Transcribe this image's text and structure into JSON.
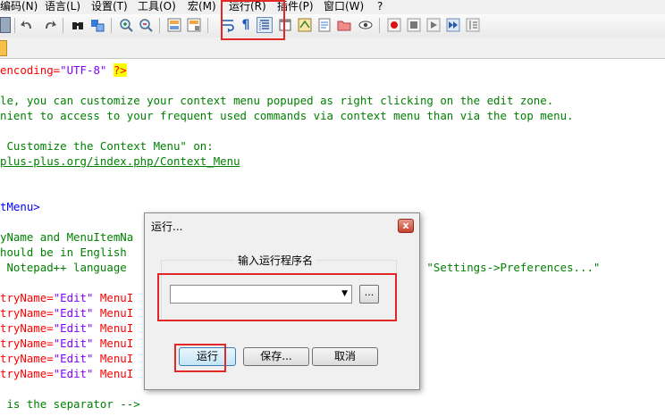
{
  "menubar": {
    "items": [
      "编码(N)",
      "语言(L)",
      "设置(T)",
      "工具(O)",
      "宏(M)",
      "运行(R)",
      "插件(P)",
      "窗口(W)",
      "?"
    ]
  },
  "editor": {
    "lines": [
      [
        {
          "t": "encoding=",
          "c": "c-red"
        },
        {
          "t": "\"UTF-8\"",
          "c": "c-purple"
        },
        {
          "t": " ",
          "c": ""
        },
        {
          "t": "?>",
          "c": "c-pi"
        }
      ],
      [],
      [
        {
          "t": "le, you can customize your context menu popuped as right clicking on the edit zone.",
          "c": "c-green"
        }
      ],
      [
        {
          "t": "nient to access to your frequent used commands via context menu than via the top menu.",
          "c": "c-green"
        }
      ],
      [],
      [
        {
          "t": " Customize the Context Menu\" on:",
          "c": "c-green"
        }
      ],
      [
        {
          "t": "plus-plus.org/index.php/Context_Menu",
          "c": "c-link"
        }
      ],
      [],
      [],
      [
        {
          "t": "tMenu>",
          "c": "c-blue"
        }
      ],
      [],
      [
        {
          "t": "yName and MenuItemNa",
          "c": "c-green"
        }
      ],
      [
        {
          "t": "hould be in English",
          "c": "c-green"
        }
      ],
      [
        {
          "t": " Notepad++ language ",
          "c": "c-green"
        },
        {
          "t": "                                   via menu \"Settings->Preferences...\"",
          "c": "c-green"
        }
      ],
      [],
      [
        {
          "t": "tryName=",
          "c": "c-red"
        },
        {
          "t": "\"Edit\"",
          "c": "c-purple"
        },
        {
          "t": " MenuI",
          "c": "c-red"
        }
      ],
      [
        {
          "t": "tryName=",
          "c": "c-red"
        },
        {
          "t": "\"Edit\"",
          "c": "c-purple"
        },
        {
          "t": " MenuI",
          "c": "c-red"
        }
      ],
      [
        {
          "t": "tryName=",
          "c": "c-red"
        },
        {
          "t": "\"Edit\"",
          "c": "c-purple"
        },
        {
          "t": " MenuI",
          "c": "c-red"
        }
      ],
      [
        {
          "t": "tryName=",
          "c": "c-red"
        },
        {
          "t": "\"Edit\"",
          "c": "c-purple"
        },
        {
          "t": " MenuI",
          "c": "c-red"
        }
      ],
      [
        {
          "t": "tryName=",
          "c": "c-red"
        },
        {
          "t": "\"Edit\"",
          "c": "c-purple"
        },
        {
          "t": " MenuI",
          "c": "c-red"
        }
      ],
      [
        {
          "t": "tryName=",
          "c": "c-red"
        },
        {
          "t": "\"Edit\"",
          "c": "c-purple"
        },
        {
          "t": " MenuI",
          "c": "c-red"
        }
      ],
      [],
      [
        {
          "t": " is the separator -->",
          "c": "c-green"
        }
      ]
    ]
  },
  "dialog": {
    "title": "运行...",
    "close_label": "x",
    "group_label": "输入运行程序名",
    "program_value": "",
    "browse_label": "...",
    "run_label": "运行",
    "save_label": "保存...",
    "cancel_label": "取消"
  },
  "colors": {
    "highlight": "#e32626",
    "accent_blue": "#3c7fb1"
  }
}
